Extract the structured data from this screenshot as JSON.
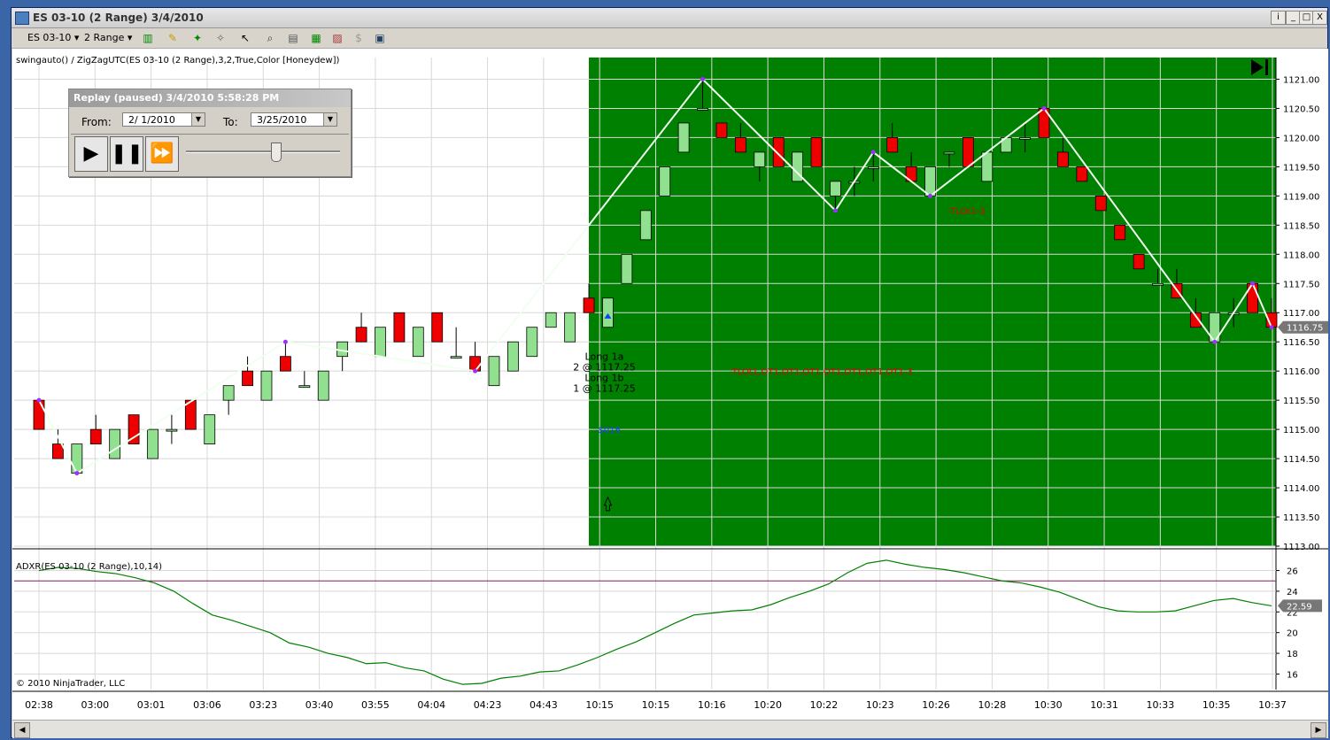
{
  "window": {
    "title": "ES 03-10 (2 Range)  3/4/2010",
    "buttons": [
      "ⅰ",
      "_",
      "□",
      "X"
    ]
  },
  "toolbar": {
    "instrument": "ES 03-10",
    "period": "2 Range"
  },
  "indicator_label": "swingauto() / ZigZagUTC(ES 03-10 (2 Range),3,2,True,Color [Honeydew])",
  "adx_label": "ADXR(ES 03-10 (2 Range),10,14)",
  "copyright": "© 2010 NinjaTrader, LLC",
  "replay": {
    "title": "Replay (paused) 3/4/2010 5:58:28 PM",
    "from_label": "From:",
    "from_value": "2/ 1/2010",
    "to_label": "To:",
    "to_value": "3/25/2010"
  },
  "annotations": {
    "long1a": "Long 1a",
    "long1a_fill": "2 @ 1117.25",
    "long1b": "Long 1b",
    "long1b_fill": "1 @ 1117.25",
    "pnl": "-$016",
    "red_label1": "-TLOt1-3",
    "red_label2": "-TLOt1,OT1,OT1,OT1,OT1,OT1,OT1,OT1-3"
  },
  "price_axis": {
    "ticks": [
      "1121.00",
      "1120.50",
      "1120.00",
      "1119.50",
      "1119.00",
      "1118.50",
      "1118.00",
      "1117.50",
      "1117.00",
      "1116.50",
      "1116.00",
      "1115.50",
      "1115.00",
      "1114.50",
      "1114.00",
      "1113.50",
      "1113.00"
    ],
    "last_price": "1116.75"
  },
  "adx_axis": {
    "ticks": [
      "26",
      "24",
      "22",
      "20",
      "18",
      "16"
    ],
    "last_value": "22.59"
  },
  "time_axis": [
    "02:38",
    "03:00",
    "03:01",
    "03:06",
    "03:23",
    "03:40",
    "03:55",
    "04:04",
    "04:23",
    "04:43",
    "10:15",
    "10:15",
    "10:16",
    "10:20",
    "10:22",
    "10:23",
    "10:26",
    "10:28",
    "10:30",
    "10:31",
    "10:33",
    "10:35",
    "10:37"
  ],
  "colors": {
    "up": "#90e090",
    "down": "#ee0000",
    "session_bg": "#008000",
    "zigzag": "#f0fff0",
    "adx_line": "#008000",
    "adx_ref": "#8b1a5a"
  },
  "chart_data": {
    "type": "candlestick",
    "price_candles": [
      {
        "o": 1115.5,
        "h": 1115.5,
        "l": 1115.0,
        "c": 1115.0
      },
      {
        "o": 1114.75,
        "h": 1115.0,
        "l": 1114.5,
        "c": 1114.5
      },
      {
        "o": 1114.25,
        "h": 1114.75,
        "l": 1114.25,
        "c": 1114.75
      },
      {
        "o": 1115.0,
        "h": 1115.25,
        "l": 1114.75,
        "c": 1114.75
      },
      {
        "o": 1114.5,
        "h": 1115.0,
        "l": 1114.5,
        "c": 1115.0
      },
      {
        "o": 1115.25,
        "h": 1115.25,
        "l": 1114.75,
        "c": 1114.75
      },
      {
        "o": 1114.5,
        "h": 1115.0,
        "l": 1114.5,
        "c": 1115.0
      },
      {
        "o": 1115.0,
        "h": 1115.25,
        "l": 1114.75,
        "c": 1115.0
      },
      {
        "o": 1115.5,
        "h": 1115.5,
        "l": 1115.0,
        "c": 1115.0
      },
      {
        "o": 1114.75,
        "h": 1115.25,
        "l": 1114.75,
        "c": 1115.25
      },
      {
        "o": 1115.5,
        "h": 1115.75,
        "l": 1115.25,
        "c": 1115.75
      },
      {
        "o": 1116.0,
        "h": 1116.25,
        "l": 1115.75,
        "c": 1115.75
      },
      {
        "o": 1115.5,
        "h": 1116.0,
        "l": 1115.5,
        "c": 1116.0
      },
      {
        "o": 1116.25,
        "h": 1116.5,
        "l": 1116.0,
        "c": 1116.0
      },
      {
        "o": 1115.75,
        "h": 1116.0,
        "l": 1115.75,
        "c": 1115.75
      },
      {
        "o": 1115.5,
        "h": 1116.0,
        "l": 1115.5,
        "c": 1116.0
      },
      {
        "o": 1116.25,
        "h": 1116.5,
        "l": 1116.0,
        "c": 1116.5
      },
      {
        "o": 1116.75,
        "h": 1117.0,
        "l": 1116.5,
        "c": 1116.5
      },
      {
        "o": 1116.25,
        "h": 1116.75,
        "l": 1116.25,
        "c": 1116.75
      },
      {
        "o": 1117.0,
        "h": 1117.0,
        "l": 1116.5,
        "c": 1116.5
      },
      {
        "o": 1116.25,
        "h": 1116.75,
        "l": 1116.25,
        "c": 1116.75
      },
      {
        "o": 1117.0,
        "h": 1117.0,
        "l": 1116.5,
        "c": 1116.5
      },
      {
        "o": 1116.25,
        "h": 1116.75,
        "l": 1116.25,
        "c": 1116.25
      },
      {
        "o": 1116.25,
        "h": 1116.5,
        "l": 1116.0,
        "c": 1116.0
      },
      {
        "o": 1115.75,
        "h": 1116.25,
        "l": 1115.75,
        "c": 1116.25
      },
      {
        "o": 1116.0,
        "h": 1116.5,
        "l": 1116.0,
        "c": 1116.5
      },
      {
        "o": 1116.25,
        "h": 1116.75,
        "l": 1116.25,
        "c": 1116.75
      },
      {
        "o": 1116.75,
        "h": 1117.0,
        "l": 1116.75,
        "c": 1117.0
      },
      {
        "o": 1116.5,
        "h": 1117.0,
        "l": 1116.5,
        "c": 1117.0
      },
      {
        "o": 1117.25,
        "h": 1117.5,
        "l": 1117.0,
        "c": 1117.0
      },
      {
        "o": 1116.75,
        "h": 1117.25,
        "l": 1116.75,
        "c": 1117.25
      },
      {
        "o": 1117.5,
        "h": 1118.0,
        "l": 1117.5,
        "c": 1118.0
      },
      {
        "o": 1118.25,
        "h": 1118.75,
        "l": 1118.25,
        "c": 1118.75
      },
      {
        "o": 1119.0,
        "h": 1119.5,
        "l": 1119.0,
        "c": 1119.5
      },
      {
        "o": 1119.75,
        "h": 1120.25,
        "l": 1119.75,
        "c": 1120.25
      },
      {
        "o": 1120.5,
        "h": 1121.0,
        "l": 1120.5,
        "c": 1120.5
      },
      {
        "o": 1120.25,
        "h": 1120.25,
        "l": 1120.0,
        "c": 1120.0
      },
      {
        "o": 1120.0,
        "h": 1120.25,
        "l": 1119.75,
        "c": 1119.75
      },
      {
        "o": 1119.5,
        "h": 1119.75,
        "l": 1119.25,
        "c": 1119.75
      },
      {
        "o": 1120.0,
        "h": 1120.0,
        "l": 1119.5,
        "c": 1119.5
      },
      {
        "o": 1119.25,
        "h": 1119.75,
        "l": 1119.25,
        "c": 1119.75
      },
      {
        "o": 1120.0,
        "h": 1120.0,
        "l": 1119.5,
        "c": 1119.5
      },
      {
        "o": 1119.0,
        "h": 1119.25,
        "l": 1118.75,
        "c": 1119.25
      },
      {
        "o": 1119.25,
        "h": 1119.5,
        "l": 1119.0,
        "c": 1119.25
      },
      {
        "o": 1119.5,
        "h": 1119.75,
        "l": 1119.25,
        "c": 1119.5
      },
      {
        "o": 1120.0,
        "h": 1120.25,
        "l": 1119.75,
        "c": 1119.75
      },
      {
        "o": 1119.5,
        "h": 1119.75,
        "l": 1119.25,
        "c": 1119.25
      },
      {
        "o": 1119.0,
        "h": 1119.5,
        "l": 1119.0,
        "c": 1119.5
      },
      {
        "o": 1119.75,
        "h": 1119.75,
        "l": 1119.5,
        "c": 1119.75
      },
      {
        "o": 1120.0,
        "h": 1120.0,
        "l": 1119.5,
        "c": 1119.5
      },
      {
        "o": 1119.25,
        "h": 1119.75,
        "l": 1119.25,
        "c": 1119.75
      },
      {
        "o": 1119.75,
        "h": 1120.0,
        "l": 1119.75,
        "c": 1120.0
      },
      {
        "o": 1120.0,
        "h": 1120.25,
        "l": 1119.75,
        "c": 1120.0
      },
      {
        "o": 1120.5,
        "h": 1120.5,
        "l": 1120.0,
        "c": 1120.0
      },
      {
        "o": 1119.75,
        "h": 1120.0,
        "l": 1119.5,
        "c": 1119.5
      },
      {
        "o": 1119.5,
        "h": 1119.5,
        "l": 1119.25,
        "c": 1119.25
      },
      {
        "o": 1119.0,
        "h": 1119.0,
        "l": 1118.75,
        "c": 1118.75
      },
      {
        "o": 1118.5,
        "h": 1118.5,
        "l": 1118.25,
        "c": 1118.25
      },
      {
        "o": 1118.0,
        "h": 1118.0,
        "l": 1117.75,
        "c": 1117.75
      },
      {
        "o": 1117.5,
        "h": 1117.75,
        "l": 1117.5,
        "c": 1117.5
      },
      {
        "o": 1117.5,
        "h": 1117.75,
        "l": 1117.25,
        "c": 1117.25
      },
      {
        "o": 1117.0,
        "h": 1117.25,
        "l": 1116.75,
        "c": 1116.75
      },
      {
        "o": 1116.5,
        "h": 1117.0,
        "l": 1116.5,
        "c": 1117.0
      },
      {
        "o": 1117.0,
        "h": 1117.25,
        "l": 1116.75,
        "c": 1117.0
      },
      {
        "o": 1117.5,
        "h": 1117.5,
        "l": 1117.0,
        "c": 1117.0
      },
      {
        "o": 1117.0,
        "h": 1117.25,
        "l": 1116.75,
        "c": 1116.75
      }
    ],
    "adx_values": [
      26.0,
      26.3,
      26.2,
      25.9,
      25.7,
      25.3,
      24.8,
      24.0,
      22.8,
      21.7,
      21.2,
      20.6,
      20.0,
      19.0,
      18.6,
      18.0,
      17.6,
      17.0,
      17.1,
      16.6,
      16.3,
      15.5,
      15.0,
      15.1,
      15.6,
      15.8,
      16.2,
      16.3,
      16.9,
      17.6,
      18.4,
      19.1,
      20.0,
      20.9,
      21.7,
      21.9,
      22.1,
      22.2,
      22.7,
      23.4,
      24.0,
      24.7,
      25.8,
      26.7,
      27.0,
      26.6,
      26.3,
      26.1,
      25.8,
      25.4,
      25.0,
      24.8,
      24.4,
      23.9,
      23.2,
      22.5,
      22.1,
      22.0,
      22.0,
      22.1,
      22.6,
      23.1,
      23.3,
      22.9,
      22.59
    ],
    "adx_reference": 25,
    "price_range": [
      1113.0,
      1121.25
    ],
    "adx_range": [
      14.5,
      27.5
    ]
  }
}
